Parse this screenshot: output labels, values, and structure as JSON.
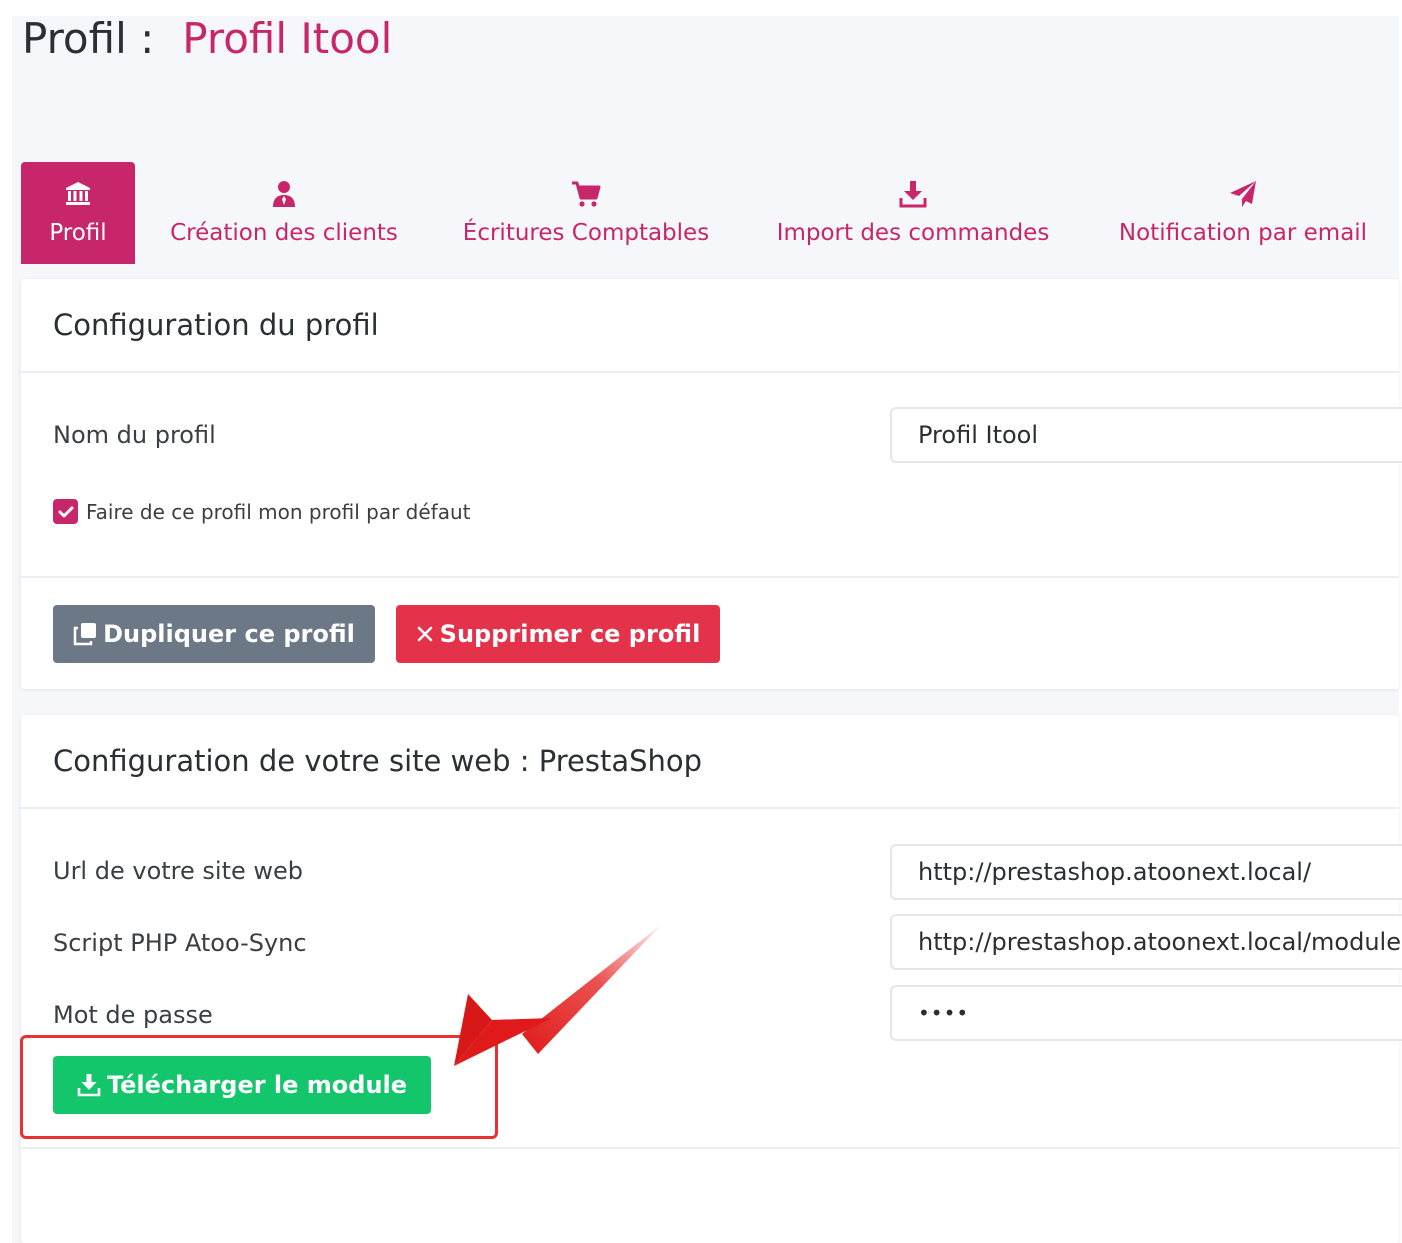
{
  "page": {
    "title_prefix": "Profil :",
    "profile_name": "Profil Itool"
  },
  "tabs": [
    {
      "label": "Profil",
      "icon": "bank-icon",
      "active": true
    },
    {
      "label": "Création des clients",
      "icon": "user-icon",
      "active": false
    },
    {
      "label": "Écritures Comptables",
      "icon": "cart-icon",
      "active": false
    },
    {
      "label": "Import des commandes",
      "icon": "download-icon",
      "active": false
    },
    {
      "label": "Notification par email",
      "icon": "paper-plane-icon",
      "active": false
    }
  ],
  "profile_card": {
    "title": "Configuration du profil",
    "name_label": "Nom du profil",
    "name_value": "Profil Itool",
    "default_checkbox_label": "Faire de ce profil mon profil par défaut",
    "default_checked": true,
    "duplicate_label": "Dupliquer ce profil",
    "delete_label": "Supprimer ce profil"
  },
  "site_card": {
    "title": "Configuration de votre site web : PrestaShop",
    "url_label": "Url de votre site web",
    "url_value": "http://prestashop.atoonext.local/",
    "script_label": "Script PHP Atoo-Sync",
    "script_value": "http://prestashop.atoonext.local/modules/atoosync/atoosync.php",
    "password_label": "Mot de passe",
    "password_value": "••••",
    "download_label": "Télécharger le module"
  },
  "colors": {
    "brand": "#c8266a",
    "grey_button": "#6c7885",
    "red_button": "#e5324b",
    "green_button": "#13c56b",
    "annotation": "#e63232"
  }
}
